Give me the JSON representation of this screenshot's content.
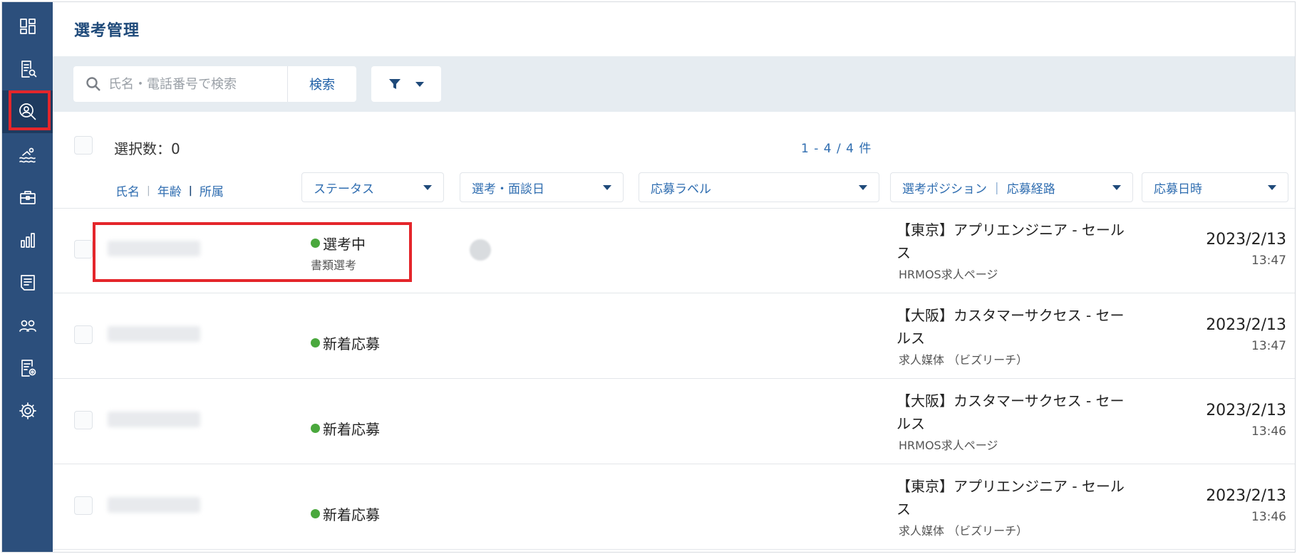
{
  "sidebar": {
    "items": [
      {
        "icon": "dashboard-icon"
      },
      {
        "icon": "document-search-icon"
      },
      {
        "icon": "candidate-search-icon",
        "active": true
      },
      {
        "icon": "swimmer-icon"
      },
      {
        "icon": "briefcase-icon"
      },
      {
        "icon": "bar-chart-icon"
      },
      {
        "icon": "checklist-icon"
      },
      {
        "icon": "users-icon"
      },
      {
        "icon": "document-settings-icon"
      },
      {
        "icon": "gear-icon"
      }
    ]
  },
  "header": {
    "title": "選考管理"
  },
  "search": {
    "placeholder": "氏名・電話番号で検索",
    "button_label": "検索"
  },
  "list": {
    "selected_label": "選択数：0",
    "pagination": "1 - 4 / 4 件",
    "sort_links": {
      "name": "氏名",
      "age": "年齢",
      "affiliation": "所属",
      "sep": "|"
    },
    "columns": {
      "status": "ステータス",
      "interview_date": "選考・面談日",
      "label": "応募ラベル",
      "position_route": "選考ポジション ｜ 応募経路",
      "applied_at": "応募日時"
    },
    "rows": [
      {
        "status": "選考中",
        "substatus": "書類選考",
        "position": "【東京】アプリエンジニア - セールス",
        "route": "HRMOS求人ページ",
        "date": "2023/2/13",
        "time": "13:47"
      },
      {
        "status": "新着応募",
        "substatus": "",
        "position": "【大阪】カスタマーサクセス - セールス",
        "route": "求人媒体 （ビズリーチ）",
        "date": "2023/2/13",
        "time": "13:47"
      },
      {
        "status": "新着応募",
        "substatus": "",
        "position": "【大阪】カスタマーサクセス - セールス",
        "route": "HRMOS求人ページ",
        "date": "2023/2/13",
        "time": "13:46"
      },
      {
        "status": "新着応募",
        "substatus": "",
        "position": "【東京】アプリエンジニア - セールス",
        "route": "求人媒体 （ビズリーチ）",
        "date": "2023/2/13",
        "time": "13:46"
      }
    ]
  },
  "colors": {
    "sidebar": "#2c4f7c",
    "accent": "#2f6db0",
    "status_green": "#4aa83d",
    "highlight": "#e4262b"
  }
}
